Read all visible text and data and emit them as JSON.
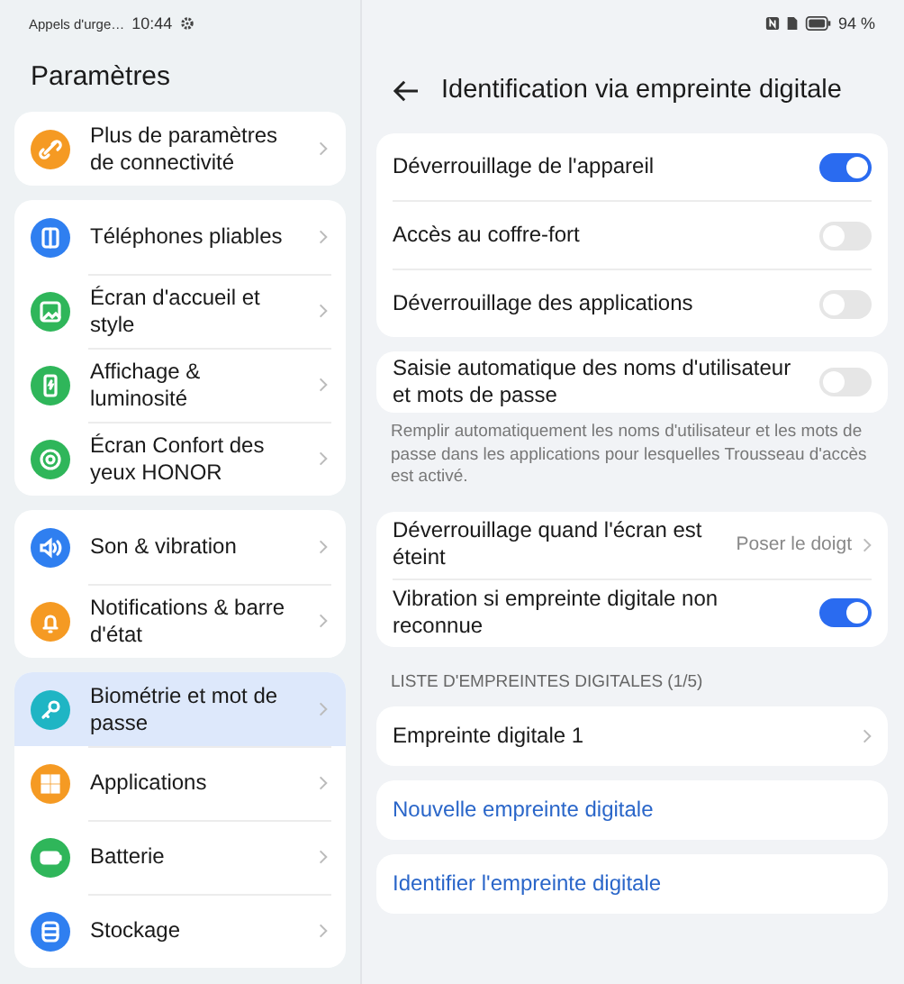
{
  "status_bar": {
    "carrier": "Appels d'urge…",
    "time": "10:44",
    "battery": "94 %"
  },
  "sidebar": {
    "title": "Paramètres",
    "groups": [
      {
        "items": [
          {
            "label": "Plus de paramètres de connectivité",
            "color": "#f59a23",
            "selected": false
          }
        ]
      },
      {
        "items": [
          {
            "label": "Téléphones pliables",
            "color": "#2f7ff0",
            "selected": false
          },
          {
            "label": "Écran d'accueil et style",
            "color": "#2fb65a",
            "selected": false
          },
          {
            "label": "Affichage & luminosité",
            "color": "#2fb65a",
            "selected": false
          },
          {
            "label": "Écran Confort des yeux HONOR",
            "color": "#2fb65a",
            "selected": false
          }
        ]
      },
      {
        "items": [
          {
            "label": "Son & vibration",
            "color": "#2f7ff0",
            "selected": false
          },
          {
            "label": "Notifications & barre d'état",
            "color": "#f59a23",
            "selected": false
          }
        ]
      },
      {
        "items": [
          {
            "label": "Biométrie et mot de passe",
            "color": "#1fb5c4",
            "selected": true
          },
          {
            "label": "Applications",
            "color": "#f59a23",
            "selected": false
          },
          {
            "label": "Batterie",
            "color": "#2fb65a",
            "selected": false
          },
          {
            "label": "Stockage",
            "color": "#2f7ff0",
            "selected": false
          }
        ]
      }
    ]
  },
  "detail": {
    "title": "Identification via empreinte digitale",
    "blocks": [
      {
        "kind": "card",
        "rows": [
          {
            "kind": "toggle",
            "label": "Déverrouillage de l'appareil",
            "on": true
          },
          {
            "kind": "toggle",
            "label": "Accès au coffre-fort",
            "on": false
          },
          {
            "kind": "toggle",
            "label": "Déverrouillage des applications",
            "on": false
          }
        ]
      },
      {
        "kind": "card",
        "rows": [
          {
            "kind": "toggle",
            "label": "Saisie automatique des noms d'utilisateur et mots de passe",
            "on": false
          }
        ]
      },
      {
        "kind": "note",
        "text": "Remplir automatiquement les noms d'utilisateur et les mots de passe dans les applications pour lesquelles Trousseau d'accès est activé."
      },
      {
        "kind": "card",
        "rows": [
          {
            "kind": "value",
            "label": "Déverrouillage quand l'écran est éteint",
            "value": "Poser le doigt"
          },
          {
            "kind": "toggle",
            "label": "Vibration si empreinte digitale non reconnue",
            "on": true
          }
        ]
      },
      {
        "kind": "header",
        "text": "LISTE D'EMPREINTES DIGITALES (1/5)"
      },
      {
        "kind": "card",
        "rows": [
          {
            "kind": "nav",
            "label": "Empreinte digitale 1"
          }
        ]
      },
      {
        "kind": "card",
        "rows": [
          {
            "kind": "action",
            "label": "Nouvelle empreinte digitale"
          }
        ]
      },
      {
        "kind": "card",
        "rows": [
          {
            "kind": "action",
            "label": "Identifier l'empreinte digitale"
          }
        ]
      }
    ]
  }
}
